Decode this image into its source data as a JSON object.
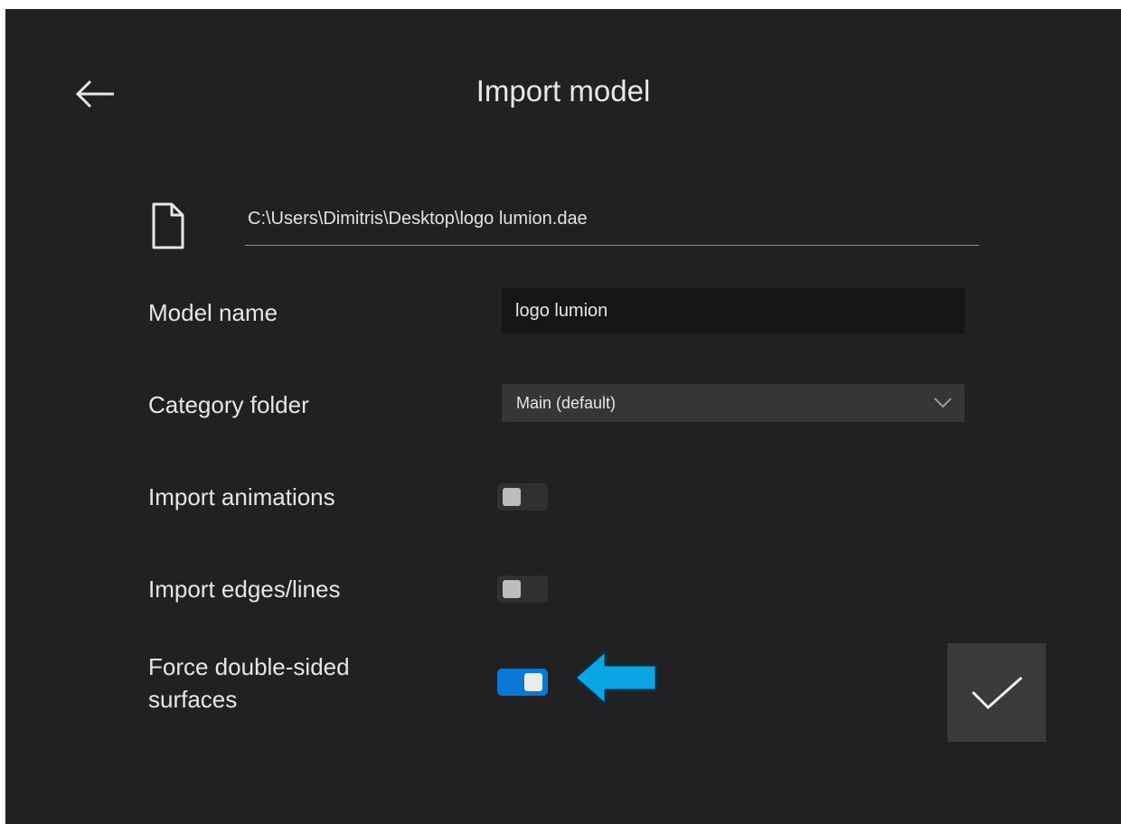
{
  "header": {
    "title": "Import model",
    "back_icon": "arrow-left-icon"
  },
  "file": {
    "icon": "file-icon",
    "path": "C:\\Users\\Dimitris\\Desktop\\logo lumion.dae"
  },
  "form": {
    "model_name_label": "Model name",
    "model_name_value": "logo lumion",
    "category_label": "Category folder",
    "category_value": "Main (default)",
    "import_animations_label": "Import animations",
    "import_animations_on": false,
    "import_edges_label": "Import edges/lines",
    "import_edges_on": false,
    "double_sided_label_line1": "Force double-sided",
    "double_sided_label_line2": "surfaces",
    "double_sided_on": true
  },
  "confirm": {
    "icon": "checkmark-icon"
  },
  "annotation": {
    "icon": "arrow-left-icon",
    "color": "#0aa6e4"
  },
  "colors": {
    "background": "#212123",
    "accent": "#0a78d6"
  }
}
